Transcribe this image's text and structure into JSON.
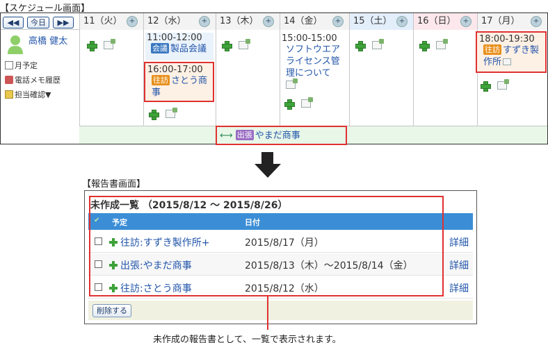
{
  "schedule": {
    "section_label": "【スケジュール画面】",
    "nav": {
      "prev": "◀◀",
      "today": "今日",
      "next": "▶▶"
    },
    "user": {
      "name": "高橋 健太"
    },
    "side_links": [
      "月予定",
      "電話メモ履歴",
      "担当確認▼"
    ],
    "days": [
      "11（火）",
      "12（水）",
      "13（木）",
      "14（金）",
      "15（土）",
      "16（日）",
      "17（月）"
    ],
    "events": {
      "d12_meeting_time": "11:00-12:00",
      "d12_meeting_badge": "会議",
      "d12_meeting_title": "製品会議",
      "d12_visit_time": "16:00-17:00",
      "d12_visit_badge": "往訪",
      "d12_visit_title": "さとう商事",
      "d14_time": "15:00-15:00",
      "d14_title": "ソフトウエアライセンス管理について",
      "d17_time": "18:00-19:30",
      "d17_badge": "往訪",
      "d17_title": "すずき製作所"
    },
    "banner": {
      "badge": "出張",
      "title": "やまだ商事"
    }
  },
  "report": {
    "section_label": "【報告書画面】",
    "title": "未作成一覧 （2015/8/12 ～ 2015/8/26）",
    "columns": {
      "subject": "予定",
      "date": "日付"
    },
    "rows": [
      {
        "title": "往訪:すずき製作所+",
        "date": "2015/8/17（月）",
        "detail": "詳細"
      },
      {
        "title": "出張:やまだ商事",
        "date": "2015/8/13（木）～2015/8/14（金）",
        "detail": "詳細"
      },
      {
        "title": "往訪:さとう商事",
        "date": "2015/8/12（水）",
        "detail": "詳細"
      }
    ],
    "delete_button": "削除する"
  },
  "caption": "未作成の報告書として、一覧で表示されます。",
  "colors": {
    "highlight": "#e03030",
    "header_blue": "#3b8ed6",
    "link": "#2255aa",
    "visit_badge": "#e8901c",
    "trip_badge": "#9a6cc4"
  }
}
